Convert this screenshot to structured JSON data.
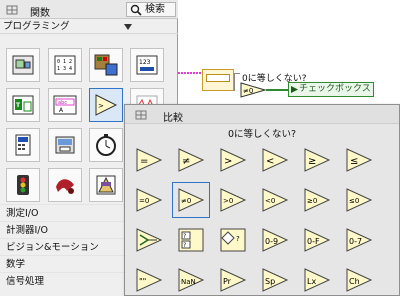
{
  "functions_palette": {
    "title": "関数",
    "search_label": "検索",
    "category": "プログラミング",
    "subcategories": [
      "測定I/O",
      "計測器I/O",
      "ビジョン&モーション",
      "数学",
      "信号処理"
    ]
  },
  "block_diagram": {
    "comparator_label": "0に等しくない?",
    "indicator_label": "チェックボックス"
  },
  "comparison_palette": {
    "title": "比較",
    "hover_label": "0に等しくない?"
  },
  "colors": {
    "selection": "#2f74c9",
    "comparison_yellow": "#fff8c8",
    "boolean_wire": "#2f8a2f",
    "numeric_wire": "#e040d0"
  }
}
